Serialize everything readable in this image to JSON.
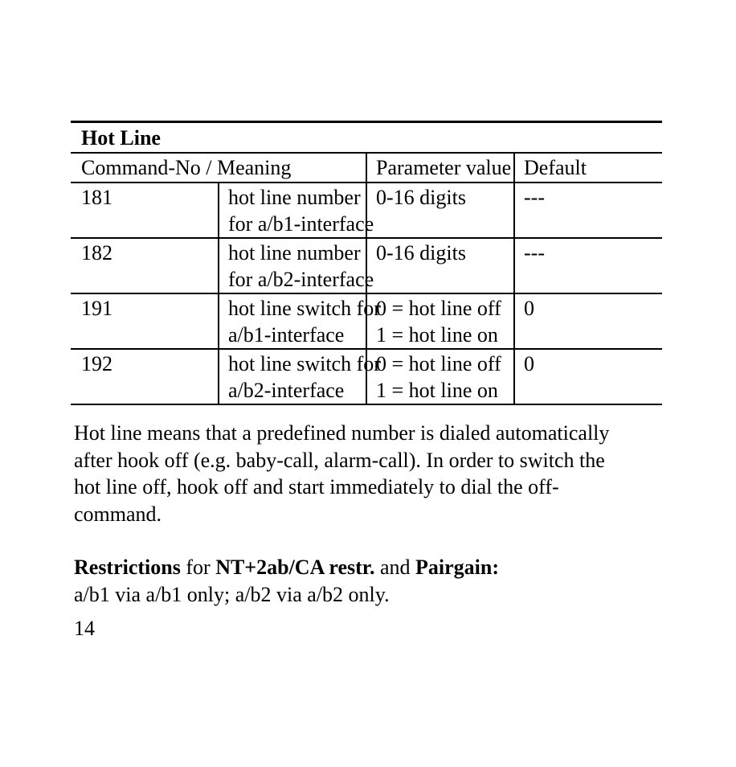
{
  "table": {
    "title": "Hot Line",
    "headers": {
      "command": "Command-No / Meaning",
      "parameter": "Parameter value",
      "default": "Default"
    },
    "rows": [
      {
        "no": "181",
        "meaning": [
          "hot line number",
          "for a/b1-interface"
        ],
        "parameter": [
          "0-16 digits",
          ""
        ],
        "default": "---"
      },
      {
        "no": "182",
        "meaning": [
          "hot line number",
          "for a/b2-interface"
        ],
        "parameter": [
          "0-16 digits",
          ""
        ],
        "default": "---"
      },
      {
        "no": "191",
        "meaning": [
          "hot line switch for",
          "a/b1-interface"
        ],
        "parameter": [
          "0 = hot line off",
          "1 = hot line on"
        ],
        "default": "0"
      },
      {
        "no": "192",
        "meaning": [
          "hot line switch for",
          "a/b2-interface"
        ],
        "parameter": [
          "0 = hot line off",
          "1 = hot line on"
        ],
        "default": "0"
      }
    ]
  },
  "description": {
    "lines": [
      "Hot line means that a predefined number is dialed automatically",
      "after hook off (e.g. baby-call, alarm-call). In order to switch the",
      "hot line off, hook off and start immediately to dial the off-",
      "command."
    ]
  },
  "restrictions": {
    "label": "Restrictions",
    "for_text": " for ",
    "product": "NT+2ab/CA restr.",
    "and_text": " and ",
    "product2": "Pairgain:",
    "detail": "a/b1 via a/b1 only; a/b2 via a/b2 only."
  },
  "page_number": "14"
}
